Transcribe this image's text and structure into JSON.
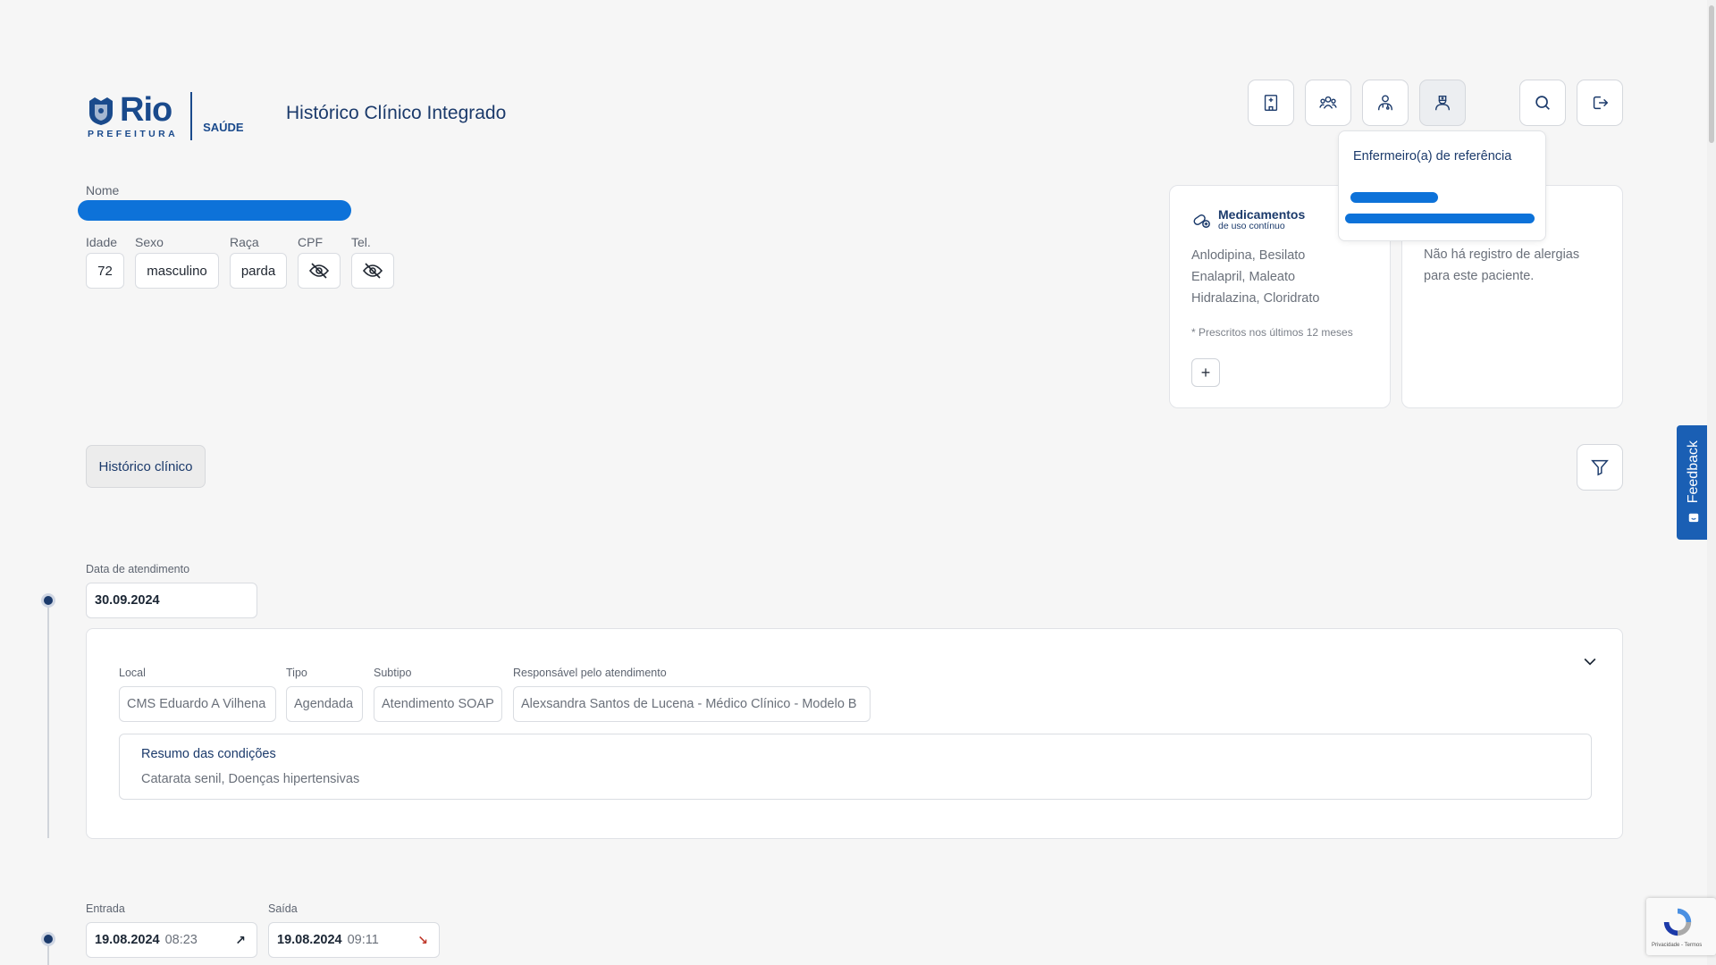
{
  "header": {
    "logo_text": "Rio",
    "logo_sub": "PREFEITURA",
    "logo_saude": "SAÚDE",
    "app_title": "Histórico Clínico Integrado",
    "buttons": [
      {
        "name": "hospital-button",
        "icon": "hospital-icon"
      },
      {
        "name": "team-button",
        "icon": "team-icon"
      },
      {
        "name": "doctor-button",
        "icon": "doctor-icon"
      },
      {
        "name": "nurse-button",
        "icon": "nurse-icon",
        "active": true
      },
      {
        "name": "search-button",
        "icon": "search-icon"
      },
      {
        "name": "logout-button",
        "icon": "logout-icon"
      }
    ]
  },
  "popover": {
    "title": "Enfermeiro(a) de referência"
  },
  "patient": {
    "name_label": "Nome",
    "labels": {
      "age": "Idade",
      "sex": "Sexo",
      "race": "Raça",
      "cpf": "CPF",
      "phone": "Tel."
    },
    "age": "72",
    "sex": "masculino",
    "race": "parda"
  },
  "medications": {
    "title": "Medicamentos",
    "subtitle": "de uso contínuo",
    "items": [
      "Anlodipina, Besilato",
      "Enalapril, Maleato",
      "Hidralazina, Cloridrato"
    ],
    "note": "* Prescritos nos últimos 12 meses",
    "add_label": "+"
  },
  "allergies": {
    "text_line1": "Não há registro de alergias",
    "text_line2": "para este paciente."
  },
  "tabs": {
    "history": "Histórico clínico"
  },
  "visit1": {
    "date_label": "Data de atendimento",
    "date": "30.09.2024",
    "labels": {
      "local": "Local",
      "tipo": "Tipo",
      "subtipo": "Subtipo",
      "resp": "Responsável pelo atendimento"
    },
    "local": "CMS Eduardo A Vilhena",
    "tipo": "Agendada",
    "subtipo": "Atendimento SOAP",
    "responsavel": "Alexsandra Santos de Lucena - Médico Clínico - Modelo B",
    "summary_title": "Resumo das condições",
    "summary_text": "Catarata senil, Doenças hipertensivas"
  },
  "visit2": {
    "entry_label": "Entrada",
    "exit_label": "Saída",
    "entry_date": "19.08.2024",
    "entry_time": "08:23",
    "exit_date": "19.08.2024",
    "exit_time": "09:11"
  },
  "feedback": {
    "label": "Feedback"
  },
  "recaptcha": {
    "text": "Privacidade - Termos"
  },
  "colors": {
    "brand": "#1b3a6b",
    "redaction": "#0d72d9",
    "feedback": "#1a5fb4"
  }
}
